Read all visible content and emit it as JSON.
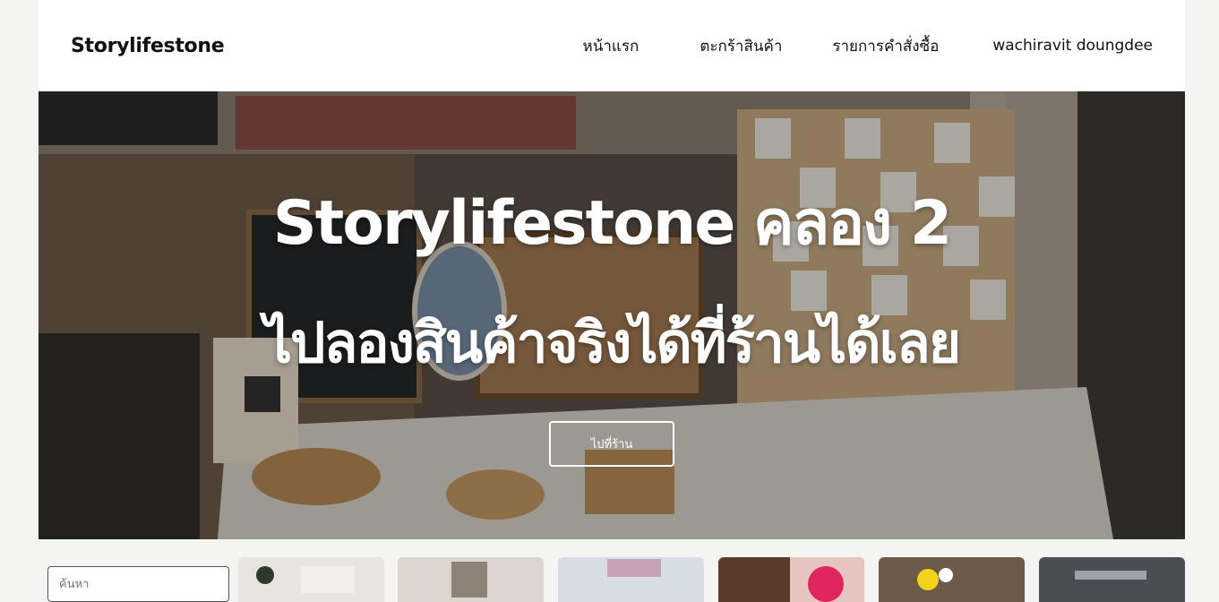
{
  "navbar": {
    "brand": "Storylifestone",
    "links": [
      "หน้าแรก",
      "ตะกร้าสินค้า",
      "รายการคำสั่งซื้อ",
      "wachiravit doungdee"
    ]
  },
  "hero": {
    "title": "Storylifestone คลอง 2",
    "subtitle": "ไปลองสินค้าจริงได้ที่ร้านได้เลย",
    "button_label": "ไปที่ร้าน"
  },
  "search": {
    "placeholder": "ค้นหา"
  },
  "colors": {
    "navbar_bg": "#ffffff",
    "page_bg": "#f4f4f2",
    "hero_text": "#ffffff"
  }
}
